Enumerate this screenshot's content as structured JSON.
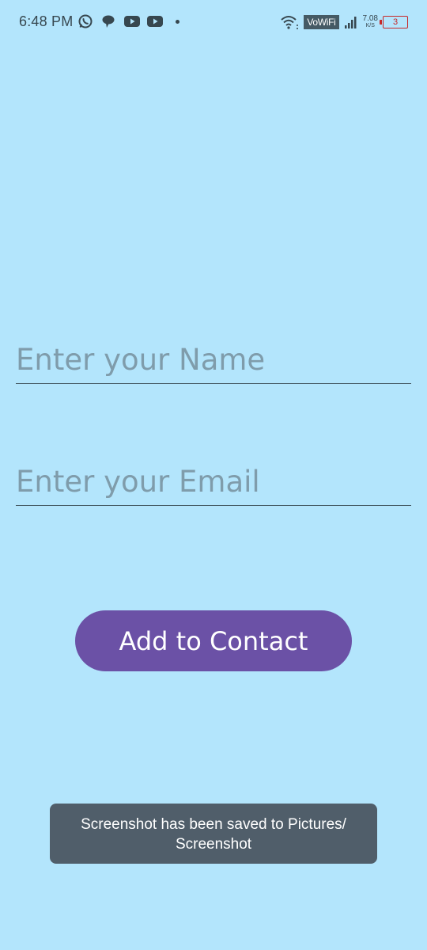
{
  "status_bar": {
    "time": "6:48 PM",
    "notification_icons": [
      "whatsapp-icon",
      "chat-bubble-icon",
      "youtube-icon",
      "youtube-icon"
    ],
    "vowifi_label": "VoWiFi",
    "network_speed_value": "7.08",
    "network_speed_unit": "K/S",
    "battery_level": "3",
    "battery_color": "#c62828"
  },
  "form": {
    "name_placeholder": "Enter your Name",
    "name_value": "",
    "email_placeholder": "Enter your Email",
    "email_value": "",
    "submit_label": "Add to Contact"
  },
  "toast": {
    "message": "Screenshot has been saved to  Pictures/\nScreenshot"
  },
  "colors": {
    "background": "#b3e5fc",
    "button": "#6b51a6",
    "toast_background": "#505e6a"
  }
}
